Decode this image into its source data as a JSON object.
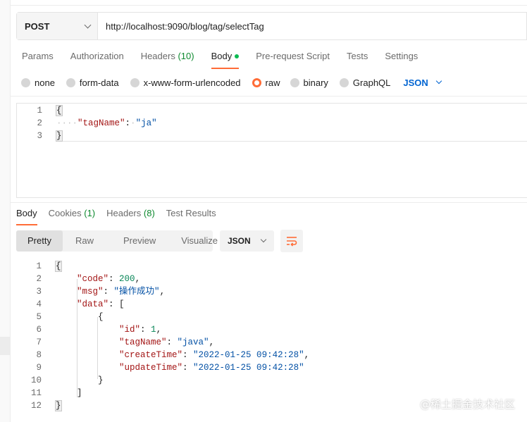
{
  "request": {
    "method": "POST",
    "url": "http://localhost:9090/blog/tag/selectTag"
  },
  "request_tabs": [
    {
      "label": "Params",
      "count": ""
    },
    {
      "label": "Authorization",
      "count": ""
    },
    {
      "label": "Headers",
      "count": "(10)"
    },
    {
      "label": "Body",
      "count": ""
    },
    {
      "label": "Pre-request Script",
      "count": ""
    },
    {
      "label": "Tests",
      "count": ""
    },
    {
      "label": "Settings",
      "count": ""
    }
  ],
  "body_types": {
    "none": "none",
    "form_data": "form-data",
    "urlencoded": "x-www-form-urlencoded",
    "raw": "raw",
    "binary": "binary",
    "graphql": "GraphQL",
    "language": "JSON"
  },
  "request_body": {
    "line_numbers": [
      "1",
      "2",
      "3"
    ],
    "key": "\"tagName\"",
    "value": "\"ja\""
  },
  "response_tabs": [
    {
      "label": "Body",
      "count": ""
    },
    {
      "label": "Cookies",
      "count": "(1)"
    },
    {
      "label": "Headers",
      "count": "(8)"
    },
    {
      "label": "Test Results",
      "count": ""
    }
  ],
  "response_view": {
    "pretty": "Pretty",
    "raw": "Raw",
    "preview": "Preview",
    "visualize": "Visualize",
    "format": "JSON"
  },
  "response_body": {
    "line_numbers": [
      "1",
      "2",
      "3",
      "4",
      "5",
      "6",
      "7",
      "8",
      "9",
      "10",
      "11",
      "12"
    ],
    "code_key": "\"code\"",
    "code_val": "200",
    "msg_key": "\"msg\"",
    "msg_val": "\"操作成功\"",
    "data_key": "\"data\"",
    "id_key": "\"id\"",
    "id_val": "1",
    "tagName_key": "\"tagName\"",
    "tagName_val": "\"java\"",
    "createTime_key": "\"createTime\"",
    "createTime_val": "\"2022-01-25 09:42:28\"",
    "updateTime_key": "\"updateTime\"",
    "updateTime_val": "\"2022-01-25 09:42:28\""
  },
  "watermark": "@稀土掘金技术社区",
  "colors": {
    "accent": "#ff6c37",
    "link_blue": "#0265d2",
    "count_green": "#0e8a2f",
    "json_key": "#a31515",
    "json_string": "#0451a5",
    "json_number": "#098658"
  },
  "icons": [
    "chevron-down-icon",
    "word-wrap-icon",
    "status-dot-icon"
  ]
}
